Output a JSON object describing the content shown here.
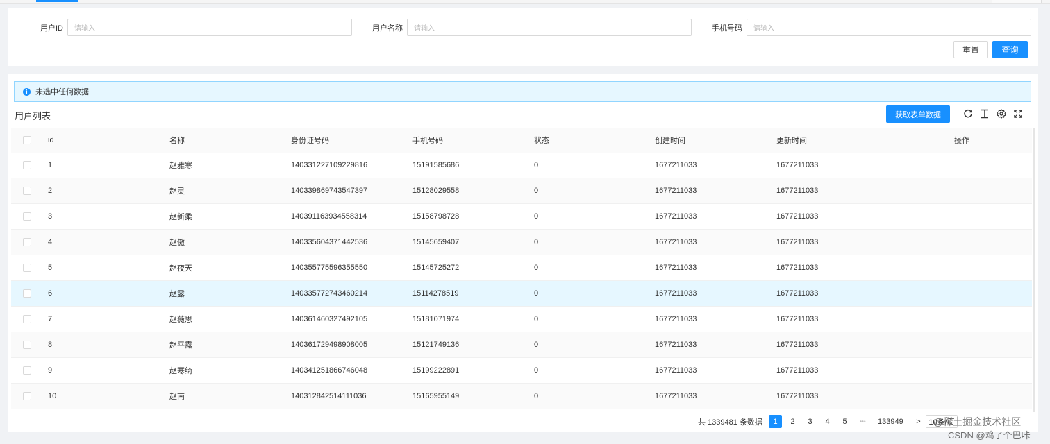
{
  "search": {
    "fields": [
      {
        "label": "用户ID",
        "placeholder": "请输入"
      },
      {
        "label": "用户名称",
        "placeholder": "请输入"
      },
      {
        "label": "手机号码",
        "placeholder": "请输入"
      }
    ],
    "reset_label": "重置",
    "query_label": "查询"
  },
  "table": {
    "alert": "未选中任何数据",
    "title": "用户列表",
    "fetch_label": "获取表单数据",
    "columns": [
      "id",
      "名称",
      "身份证号码",
      "手机号码",
      "状态",
      "创建时间",
      "更新时间",
      "操作"
    ],
    "rows": [
      {
        "id": "1",
        "name": "赵雅寒",
        "idcard": "140331227109229816",
        "phone": "15191585686",
        "status": "0",
        "created": "1677211033",
        "updated": "1677211033"
      },
      {
        "id": "2",
        "name": "赵灵",
        "idcard": "140339869743547397",
        "phone": "15128029558",
        "status": "0",
        "created": "1677211033",
        "updated": "1677211033"
      },
      {
        "id": "3",
        "name": "赵新柔",
        "idcard": "140391163934558314",
        "phone": "15158798728",
        "status": "0",
        "created": "1677211033",
        "updated": "1677211033"
      },
      {
        "id": "4",
        "name": "赵傲",
        "idcard": "140335604371442536",
        "phone": "15145659407",
        "status": "0",
        "created": "1677211033",
        "updated": "1677211033"
      },
      {
        "id": "5",
        "name": "赵夜天",
        "idcard": "140355775596355550",
        "phone": "15145725272",
        "status": "0",
        "created": "1677211033",
        "updated": "1677211033"
      },
      {
        "id": "6",
        "name": "赵露",
        "idcard": "140335772743460214",
        "phone": "15114278519",
        "status": "0",
        "created": "1677211033",
        "updated": "1677211033"
      },
      {
        "id": "7",
        "name": "赵薇思",
        "idcard": "140361460327492105",
        "phone": "15181071974",
        "status": "0",
        "created": "1677211033",
        "updated": "1677211033"
      },
      {
        "id": "8",
        "name": "赵平露",
        "idcard": "140361729498908005",
        "phone": "15121749136",
        "status": "0",
        "created": "1677211033",
        "updated": "1677211033"
      },
      {
        "id": "9",
        "name": "赵寒绮",
        "idcard": "140341251866746048",
        "phone": "15199222891",
        "status": "0",
        "created": "1677211033",
        "updated": "1677211033"
      },
      {
        "id": "10",
        "name": "赵南",
        "idcard": "140312842514111036",
        "phone": "15165955149",
        "status": "0",
        "created": "1677211033",
        "updated": "1677211033"
      }
    ]
  },
  "pagination": {
    "total_text": "共 1339481 条数据",
    "pages": [
      "1",
      "2",
      "3",
      "4",
      "5"
    ],
    "ellipsis": "•••",
    "last_page": "133949",
    "next": ">",
    "page_size": "10条/页"
  },
  "watermark": {
    "line1": "@稀土掘金技术社区",
    "line2": "CSDN @鸡了个巴咔"
  },
  "colors": {
    "primary": "#1890ff",
    "alert_bg": "#e6f7ff",
    "row_highlight": "#e6f7ff"
  },
  "icons": [
    "info-icon",
    "reload-icon",
    "column-height-icon",
    "setting-icon",
    "fullscreen-icon"
  ]
}
